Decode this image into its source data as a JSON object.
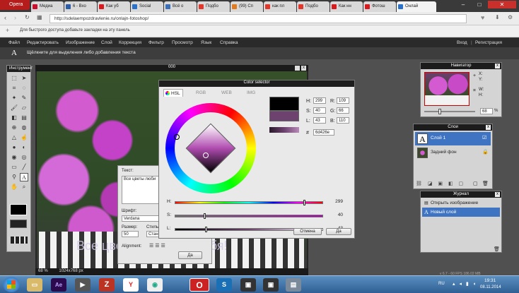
{
  "browser": {
    "opera_label": "Opera",
    "tabs": [
      {
        "label": "Медиа",
        "color": "#c8102e"
      },
      {
        "label": "6 - Вхо",
        "color": "#2c5ea8"
      },
      {
        "label": "Как уб",
        "color": "#d71920"
      },
      {
        "label": "Social",
        "color": "#2a72c9"
      },
      {
        "label": "Всё о",
        "color": "#3d6fb6"
      },
      {
        "label": "Подбо",
        "color": "#e0382c"
      },
      {
        "label": "(99) Сп",
        "color": "#e07b1f"
      },
      {
        "label": "как пл",
        "color": "#e0382c"
      },
      {
        "label": "Подбо",
        "color": "#e0382c"
      },
      {
        "label": "Как нн",
        "color": "#d71920"
      },
      {
        "label": "Фотош",
        "color": "#d71920"
      },
      {
        "label": "Онлай",
        "color": "#2a72c9"
      }
    ],
    "url": "http://sdelaempozdravlenie.ru/onlajn-fotoshop/",
    "bookmarks_hint": "Для быстрого доступа добавьте закладки на эту панель"
  },
  "app": {
    "menu": [
      "Файл",
      "Редактировать",
      "Изображение",
      "Слой",
      "Коррекция",
      "Фильтр",
      "Просмотр",
      "Язык",
      "Справка"
    ],
    "login": "Вход",
    "register": "Регистрация",
    "hint": "Щёлкните для выделения либо добавления текста",
    "tools_title": "Инструмент",
    "canvas_title": "000",
    "status_zoom": "68",
    "status_pct": "%",
    "status_size": "1024x768 px",
    "canvas_text": "Все цветы лю... для тебя!",
    "fps_info": "v 6.7 - 60 FPS 186.02 MB"
  },
  "text_dialog": {
    "text_label": "Текст:",
    "text_value": "Все цветы люби",
    "font_label": "Шрифт:",
    "font_value": "Verdana",
    "size_label": "Размер:",
    "size_value": "50",
    "style_label": "Стиль",
    "style_value": "Стан",
    "align_label": "Alignment:",
    "ok": "Да"
  },
  "color_selector": {
    "title": "Color selector",
    "tabs": [
      "HSL",
      "RGB",
      "WEB",
      "IMG"
    ],
    "H": "299",
    "S": "40",
    "L": "43",
    "R": "109",
    "G": "66",
    "B": "110",
    "hex": "6d426e",
    "hash": "#",
    "cancel": "Отмена",
    "ok": "Да",
    "current_color": "#6d426e",
    "h_label": "H:",
    "s_label": "S:",
    "l_label": "L:",
    "r_label": "R:",
    "g_label": "G:",
    "b_label": "B:"
  },
  "navigator": {
    "title": "Навигатор",
    "x": "X:",
    "y": "Y:",
    "w": "W:",
    "h": "H:",
    "zoom": "68",
    "zoom_pct": "%"
  },
  "layers": {
    "title": "Слои",
    "items": [
      "Слой 1",
      "Задний фон"
    ]
  },
  "history": {
    "title": "Журнал",
    "items": [
      "Открыть изображение",
      "Новый слой"
    ]
  },
  "taskbar": {
    "lang": "RU",
    "time": "19:31",
    "date": "08.11.2014"
  }
}
